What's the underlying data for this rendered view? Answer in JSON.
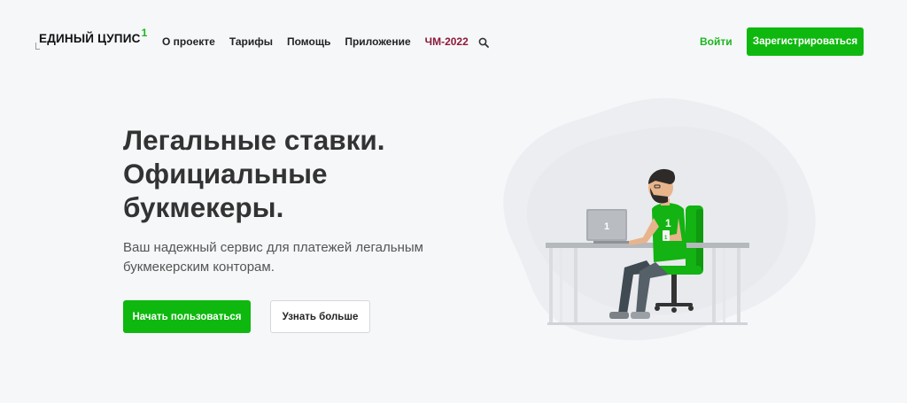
{
  "header": {
    "logo_text": "ЕДИНЫЙ ЦУПИС",
    "logo_sup": "1",
    "nav": [
      {
        "label": "О проекте"
      },
      {
        "label": "Тарифы"
      },
      {
        "label": "Помощь"
      },
      {
        "label": "Приложение"
      },
      {
        "label": "ЧМ-2022",
        "highlight": true
      }
    ],
    "search_icon": "search-icon",
    "login_label": "Войти",
    "register_label": "Зарегистрироваться"
  },
  "hero": {
    "title_lines": [
      "Легальные ставки.",
      "Официальные",
      "букмекеры."
    ],
    "subtitle_lines": [
      "Ваш надежный сервис для платежей легальным",
      "букмекерским конторам."
    ],
    "primary_button": "Начать пользоваться",
    "secondary_button": "Узнать больше"
  },
  "illustration": {
    "laptop_badge": "1",
    "shirt_badge": "1",
    "cup_badge": "1"
  },
  "colors": {
    "accent_green": "#0fb80f",
    "highlight_red": "#8c1a3a",
    "background": "#f6f7f9"
  }
}
